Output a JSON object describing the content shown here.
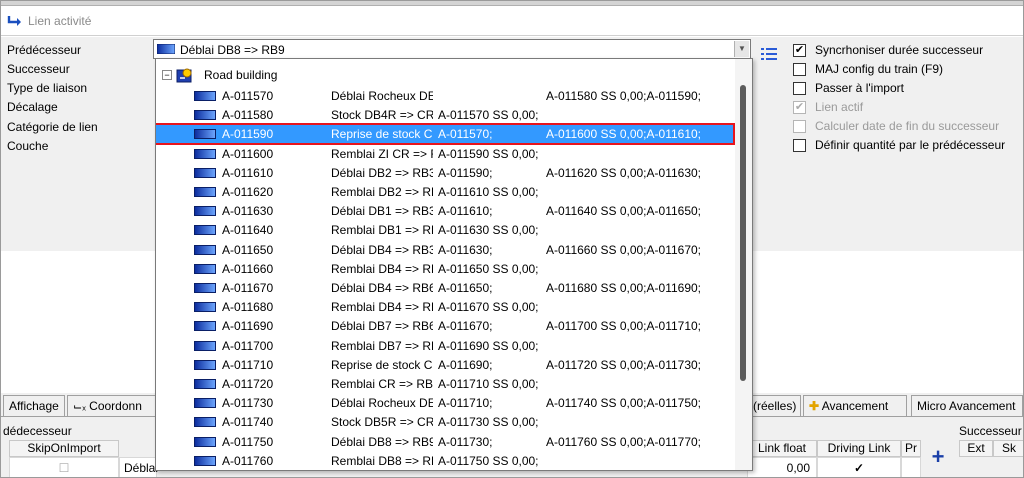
{
  "window": {
    "title": "Lien activité",
    "background_row_hint": ""
  },
  "form": {
    "labels": [
      "Prédécesseur",
      "Successeur",
      "Type de liaison",
      "Décalage",
      "Catégorie de lien",
      "Couche"
    ],
    "predecessor_value": "Déblai DB8 => RB9",
    "options": [
      {
        "label": "Syncrhoniser durée successeur",
        "checked": true,
        "disabled": false
      },
      {
        "label": "MAJ config du train (F9)",
        "checked": false,
        "disabled": false
      },
      {
        "label": "Passer à l'import",
        "checked": false,
        "disabled": false
      },
      {
        "label": "Lien actif",
        "checked": true,
        "disabled": true
      },
      {
        "label": "Calculer date de fin du successeur",
        "checked": false,
        "disabled": true
      },
      {
        "label": "Définir quantité par le prédécesseur",
        "checked": false,
        "disabled": false
      }
    ]
  },
  "dropdown": {
    "root_label": "Road building",
    "items": [
      {
        "id": "A-011570",
        "name": "Déblai Rocheux DE",
        "pred": "",
        "succ": "A-011580 SS 0,00;A-011590;"
      },
      {
        "id": "A-011580",
        "name": "Stock DB4R => CR",
        "pred": "A-011570 SS 0,00;",
        "succ": ""
      },
      {
        "id": "A-011590",
        "name": "Reprise de stock C",
        "pred": "A-011570;",
        "succ": "A-011600 SS 0,00;A-011610;"
      },
      {
        "id": "A-011600",
        "name": "Remblai ZI CR => R",
        "pred": "A-011590 SS 0,00;",
        "succ": ""
      },
      {
        "id": "A-011610",
        "name": "Déblai DB2 => RB3",
        "pred": "A-011590;",
        "succ": "A-011620 SS 0,00;A-011630;"
      },
      {
        "id": "A-011620",
        "name": "Remblai DB2 => RE",
        "pred": "A-011610 SS 0,00;",
        "succ": ""
      },
      {
        "id": "A-011630",
        "name": "Déblai DB1 => RB3",
        "pred": "A-011610;",
        "succ": "A-011640 SS 0,00;A-011650;"
      },
      {
        "id": "A-011640",
        "name": "Remblai DB1 => RE",
        "pred": "A-011630 SS 0,00;",
        "succ": ""
      },
      {
        "id": "A-011650",
        "name": "Déblai DB4 => RB3",
        "pred": "A-011630;",
        "succ": "A-011660 SS 0,00;A-011670;"
      },
      {
        "id": "A-011660",
        "name": "Remblai DB4 => RE",
        "pred": "A-011650 SS 0,00;",
        "succ": ""
      },
      {
        "id": "A-011670",
        "name": "Déblai DB4 => RB6",
        "pred": "A-011650;",
        "succ": "A-011680 SS 0,00;A-011690;"
      },
      {
        "id": "A-011680",
        "name": "Remblai DB4 => RE",
        "pred": "A-011670 SS 0,00;",
        "succ": ""
      },
      {
        "id": "A-011690",
        "name": "Déblai DB7 => RB6",
        "pred": "A-011670;",
        "succ": "A-011700 SS 0,00;A-011710;"
      },
      {
        "id": "A-011700",
        "name": "Remblai DB7 => RE",
        "pred": "A-011690 SS 0,00;",
        "succ": ""
      },
      {
        "id": "A-011710",
        "name": "Reprise de stock C",
        "pred": "A-011690;",
        "succ": "A-011720 SS 0,00;A-011730;"
      },
      {
        "id": "A-011720",
        "name": "Remblai CR => RB6",
        "pred": "A-011710 SS 0,00;",
        "succ": ""
      },
      {
        "id": "A-011730",
        "name": "Déblai Rocheux DE",
        "pred": "A-011710;",
        "succ": "A-011740 SS 0,00;A-011750;"
      },
      {
        "id": "A-011740",
        "name": "Stock DB5R => CR",
        "pred": "A-011730 SS 0,00;",
        "succ": ""
      },
      {
        "id": "A-011750",
        "name": "Déblai DB8 => RB9",
        "pred": "A-011730;",
        "succ": "A-011760 SS 0,00;A-011770;"
      },
      {
        "id": "A-011760",
        "name": "Remblai DB8 => RE",
        "pred": "A-011750 SS 0,00;",
        "succ": ""
      }
    ],
    "selected_index": 2
  },
  "tabs": {
    "affichage": "Affichage",
    "coordonnees": "Coordonn",
    "reelles": "(réelles)",
    "avancement": "Avancement",
    "micro_avancement": "Micro Avancement"
  },
  "bottom": {
    "left_section": "dédecesseur",
    "skip_col": "SkipOnImport",
    "row_text": "Déblai",
    "link_float_col": "Link float",
    "driving_link_col": "Driving Link",
    "pr_col": "Pr",
    "link_float_value": "0,00",
    "driving_check": "✓",
    "right_section": "Successeur",
    "ext_col": "Ext",
    "sk_col": "Sk"
  },
  "colors": {
    "selection": "#3399ff",
    "highlight_border": "#e8141c",
    "accent_blue": "#1a3fa8"
  }
}
